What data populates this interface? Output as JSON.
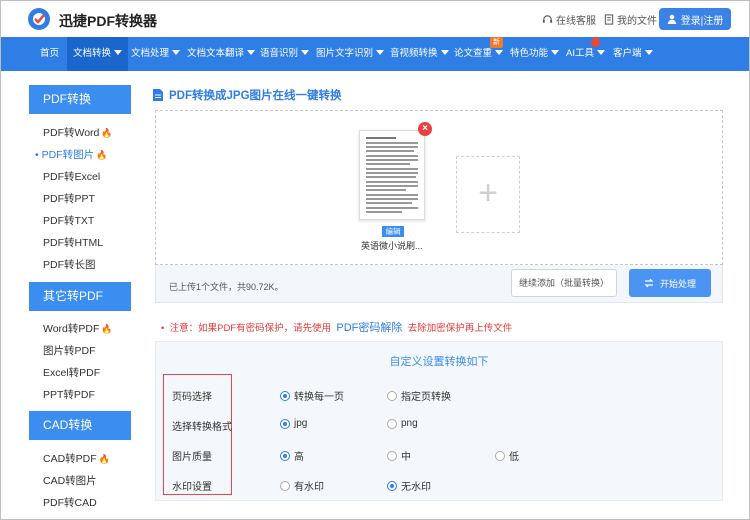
{
  "header": {
    "brand": "迅捷PDF转换器",
    "service_link": "在线客服",
    "files_link": "我的文件",
    "login": "登录|注册"
  },
  "nav": {
    "items": [
      "首页",
      "文档转换",
      "文档处理",
      "文档文本翻译",
      "语音识别",
      "图片文字识别",
      "音视频转换",
      "论文查重",
      "特色功能",
      "AI工具",
      "客户端"
    ],
    "new_badge": "新"
  },
  "sidebar": {
    "pdf_convert": {
      "title": "PDF转换",
      "items": [
        "PDF转Word",
        "PDF转图片",
        "PDF转Excel",
        "PDF转PPT",
        "PDF转TXT",
        "PDF转HTML",
        "PDF转长图"
      ]
    },
    "other_to_pdf": {
      "title": "其它转PDF",
      "items": [
        "Word转PDF",
        "图片转PDF",
        "Excel转PDF",
        "PPT转PDF"
      ]
    },
    "cad": {
      "title": "CAD转换",
      "items": [
        "CAD转PDF",
        "CAD转图片",
        "PDF转CAD"
      ]
    }
  },
  "main": {
    "title": "PDF转换成JPG图片在线一键转换",
    "file_name": "英语微小说刷...",
    "edit_tag": "编辑",
    "upload_info": "已上传1个文件，共90.72K。",
    "continue_btn": "继续添加（批量转换）",
    "start_btn": "开始处理",
    "notice_prefix": "注意：如果PDF有密码保护，请先使用",
    "notice_link": "PDF密码解除",
    "notice_suffix": "去除加密保护再上传文件"
  },
  "settings": {
    "title": "自定义设置转换如下",
    "rows": [
      {
        "label": "页码选择",
        "options": [
          "转换每一页",
          "指定页转换"
        ],
        "selected": "转换每一页"
      },
      {
        "label": "选择转换格式",
        "options": [
          "jpg",
          "png"
        ],
        "selected": "jpg"
      },
      {
        "label": "图片质量",
        "options": [
          "高",
          "中",
          "低"
        ],
        "selected": "高"
      },
      {
        "label": "水印设置",
        "options": [
          "有水印",
          "无水印"
        ],
        "selected": "无水印"
      }
    ]
  },
  "colors": {
    "accent": "#2f7ee6",
    "warning": "#e83a3a",
    "fire": "#f06c22"
  }
}
